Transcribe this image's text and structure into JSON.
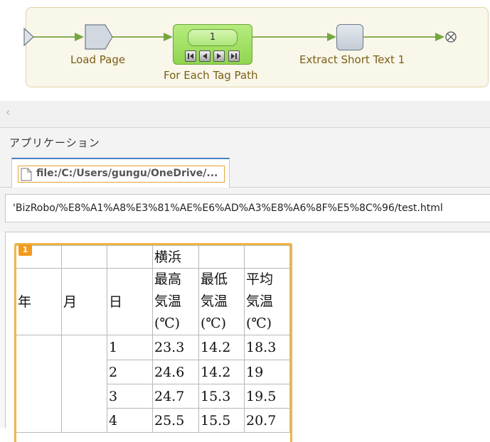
{
  "workflow": {
    "steps": [
      {
        "label": "Load Page"
      },
      {
        "label": "For Each Tag Path",
        "counter": "1"
      },
      {
        "label": "Extract Short Text 1"
      }
    ]
  },
  "application": {
    "title": "アプリケーション",
    "tab": {
      "label": "file:/C:/Users/gungu/OneDrive/..."
    },
    "url": "'BizRobo/%E8%A1%A8%E3%81%AE%E6%AD%A3%E8%A6%8F%E5%8C%96/test.html"
  },
  "table": {
    "badge": "1",
    "location_header": "横浜",
    "headers": {
      "year": "年",
      "month": "月",
      "day": "日",
      "max": [
        "最高",
        "気温",
        "(℃)"
      ],
      "min": [
        "最低",
        "気温",
        "(℃)"
      ],
      "avg": [
        "平均",
        "気温",
        "(℃)"
      ]
    },
    "rows": [
      {
        "day": "1",
        "max": "23.3",
        "min": "14.2",
        "avg": "18.3"
      },
      {
        "day": "2",
        "max": "24.6",
        "min": "14.2",
        "avg": "19"
      },
      {
        "day": "3",
        "max": "24.7",
        "min": "15.3",
        "avg": "19.5"
      },
      {
        "day": "4",
        "max": "25.5",
        "min": "15.5",
        "avg": "20.7"
      }
    ]
  },
  "colors": {
    "loop_node": "#9fdc5f",
    "tag_highlight": "#f0b445",
    "tab_accent": "#4a7fbf"
  }
}
